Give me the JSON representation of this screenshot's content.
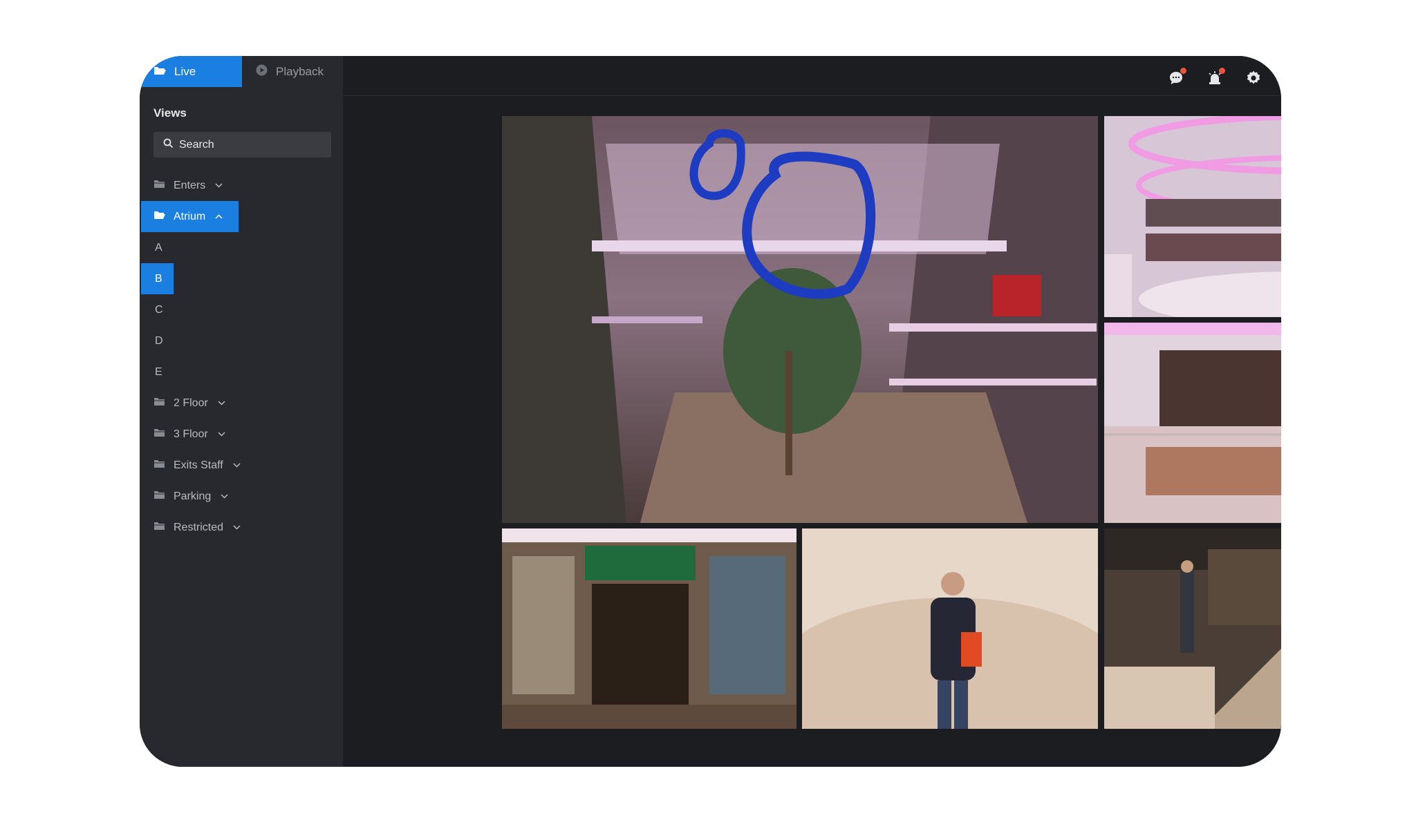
{
  "tabs": {
    "live": "Live",
    "playback": "Playback"
  },
  "sidebar": {
    "title": "Views",
    "search_placeholder": "Search",
    "groups": [
      {
        "label": "Enters",
        "expanded": false
      },
      {
        "label": "Atrium",
        "expanded": true,
        "active": true
      },
      {
        "label": "2 Floor",
        "expanded": false
      },
      {
        "label": "3 Floor",
        "expanded": false
      },
      {
        "label": "Exits Staff",
        "expanded": false
      },
      {
        "label": "Parking",
        "expanded": false
      },
      {
        "label": "Restricted",
        "expanded": false
      }
    ],
    "atrium_children": [
      "A",
      "B",
      "C",
      "D",
      "E"
    ],
    "selected_child": "B"
  },
  "topbar": {
    "icons": [
      "chat-notification-icon",
      "alarm-notification-icon",
      "gear-icon"
    ]
  },
  "cameras": [
    {
      "id": "main-atrium",
      "scene": "mall atrium"
    },
    {
      "id": "upper-rings",
      "scene": "circular balconies"
    },
    {
      "id": "cafe",
      "scene": "cafe seating"
    },
    {
      "id": "storefront",
      "scene": "shop entrance"
    },
    {
      "id": "person",
      "scene": "person standing"
    },
    {
      "id": "railing",
      "scene": "guard at railing"
    }
  ],
  "colors": {
    "accent": "#1a7fe0",
    "badge": "#f0533a",
    "sidebar": "#27292e",
    "main": "#1c1d21"
  }
}
